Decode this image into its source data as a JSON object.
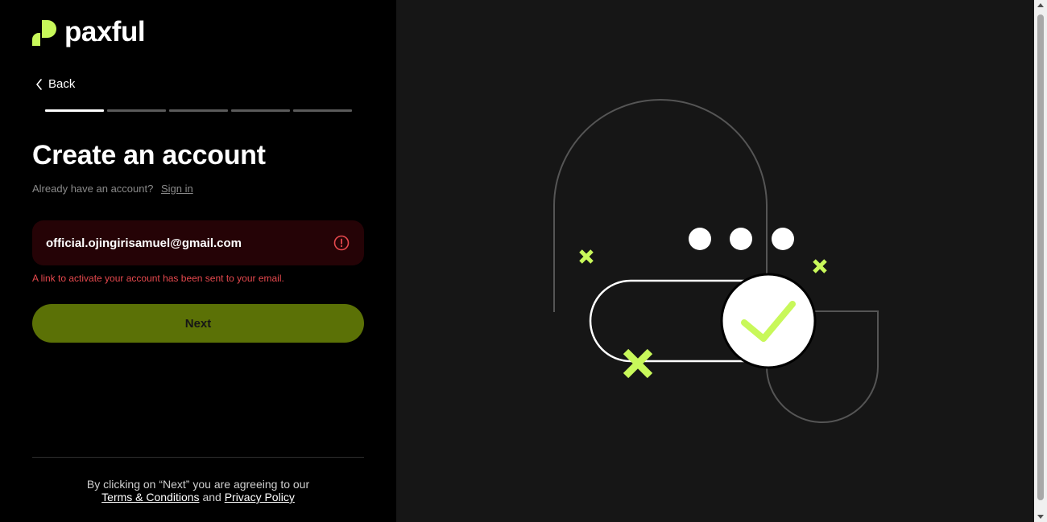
{
  "brand": {
    "name": "paxful",
    "accent_color": "#c8f85a"
  },
  "nav": {
    "back_label": "Back",
    "back_icon": "chevron-left-icon"
  },
  "progress": {
    "total_steps": 5,
    "current_step": 1
  },
  "form": {
    "title": "Create an account",
    "signin_prompt": "Already have an account?",
    "signin_link": "Sign in",
    "email_value": "official.ojingirisamuel@gmail.com",
    "email_status_icon": "alert-circle-icon",
    "error_message": "A link to activate your account has been sent to your email.",
    "next_label": "Next"
  },
  "footer": {
    "terms_prefix": "By clicking on “Next” you are agreeing to our",
    "terms_link": "Terms & Conditions",
    "and_text": "and",
    "privacy_link": "Privacy Policy"
  },
  "colors": {
    "left_bg": "#000000",
    "right_bg": "#161616",
    "button_bg": "#5b7106",
    "input_error_bg": "#250306",
    "error_text": "#e5484d"
  }
}
